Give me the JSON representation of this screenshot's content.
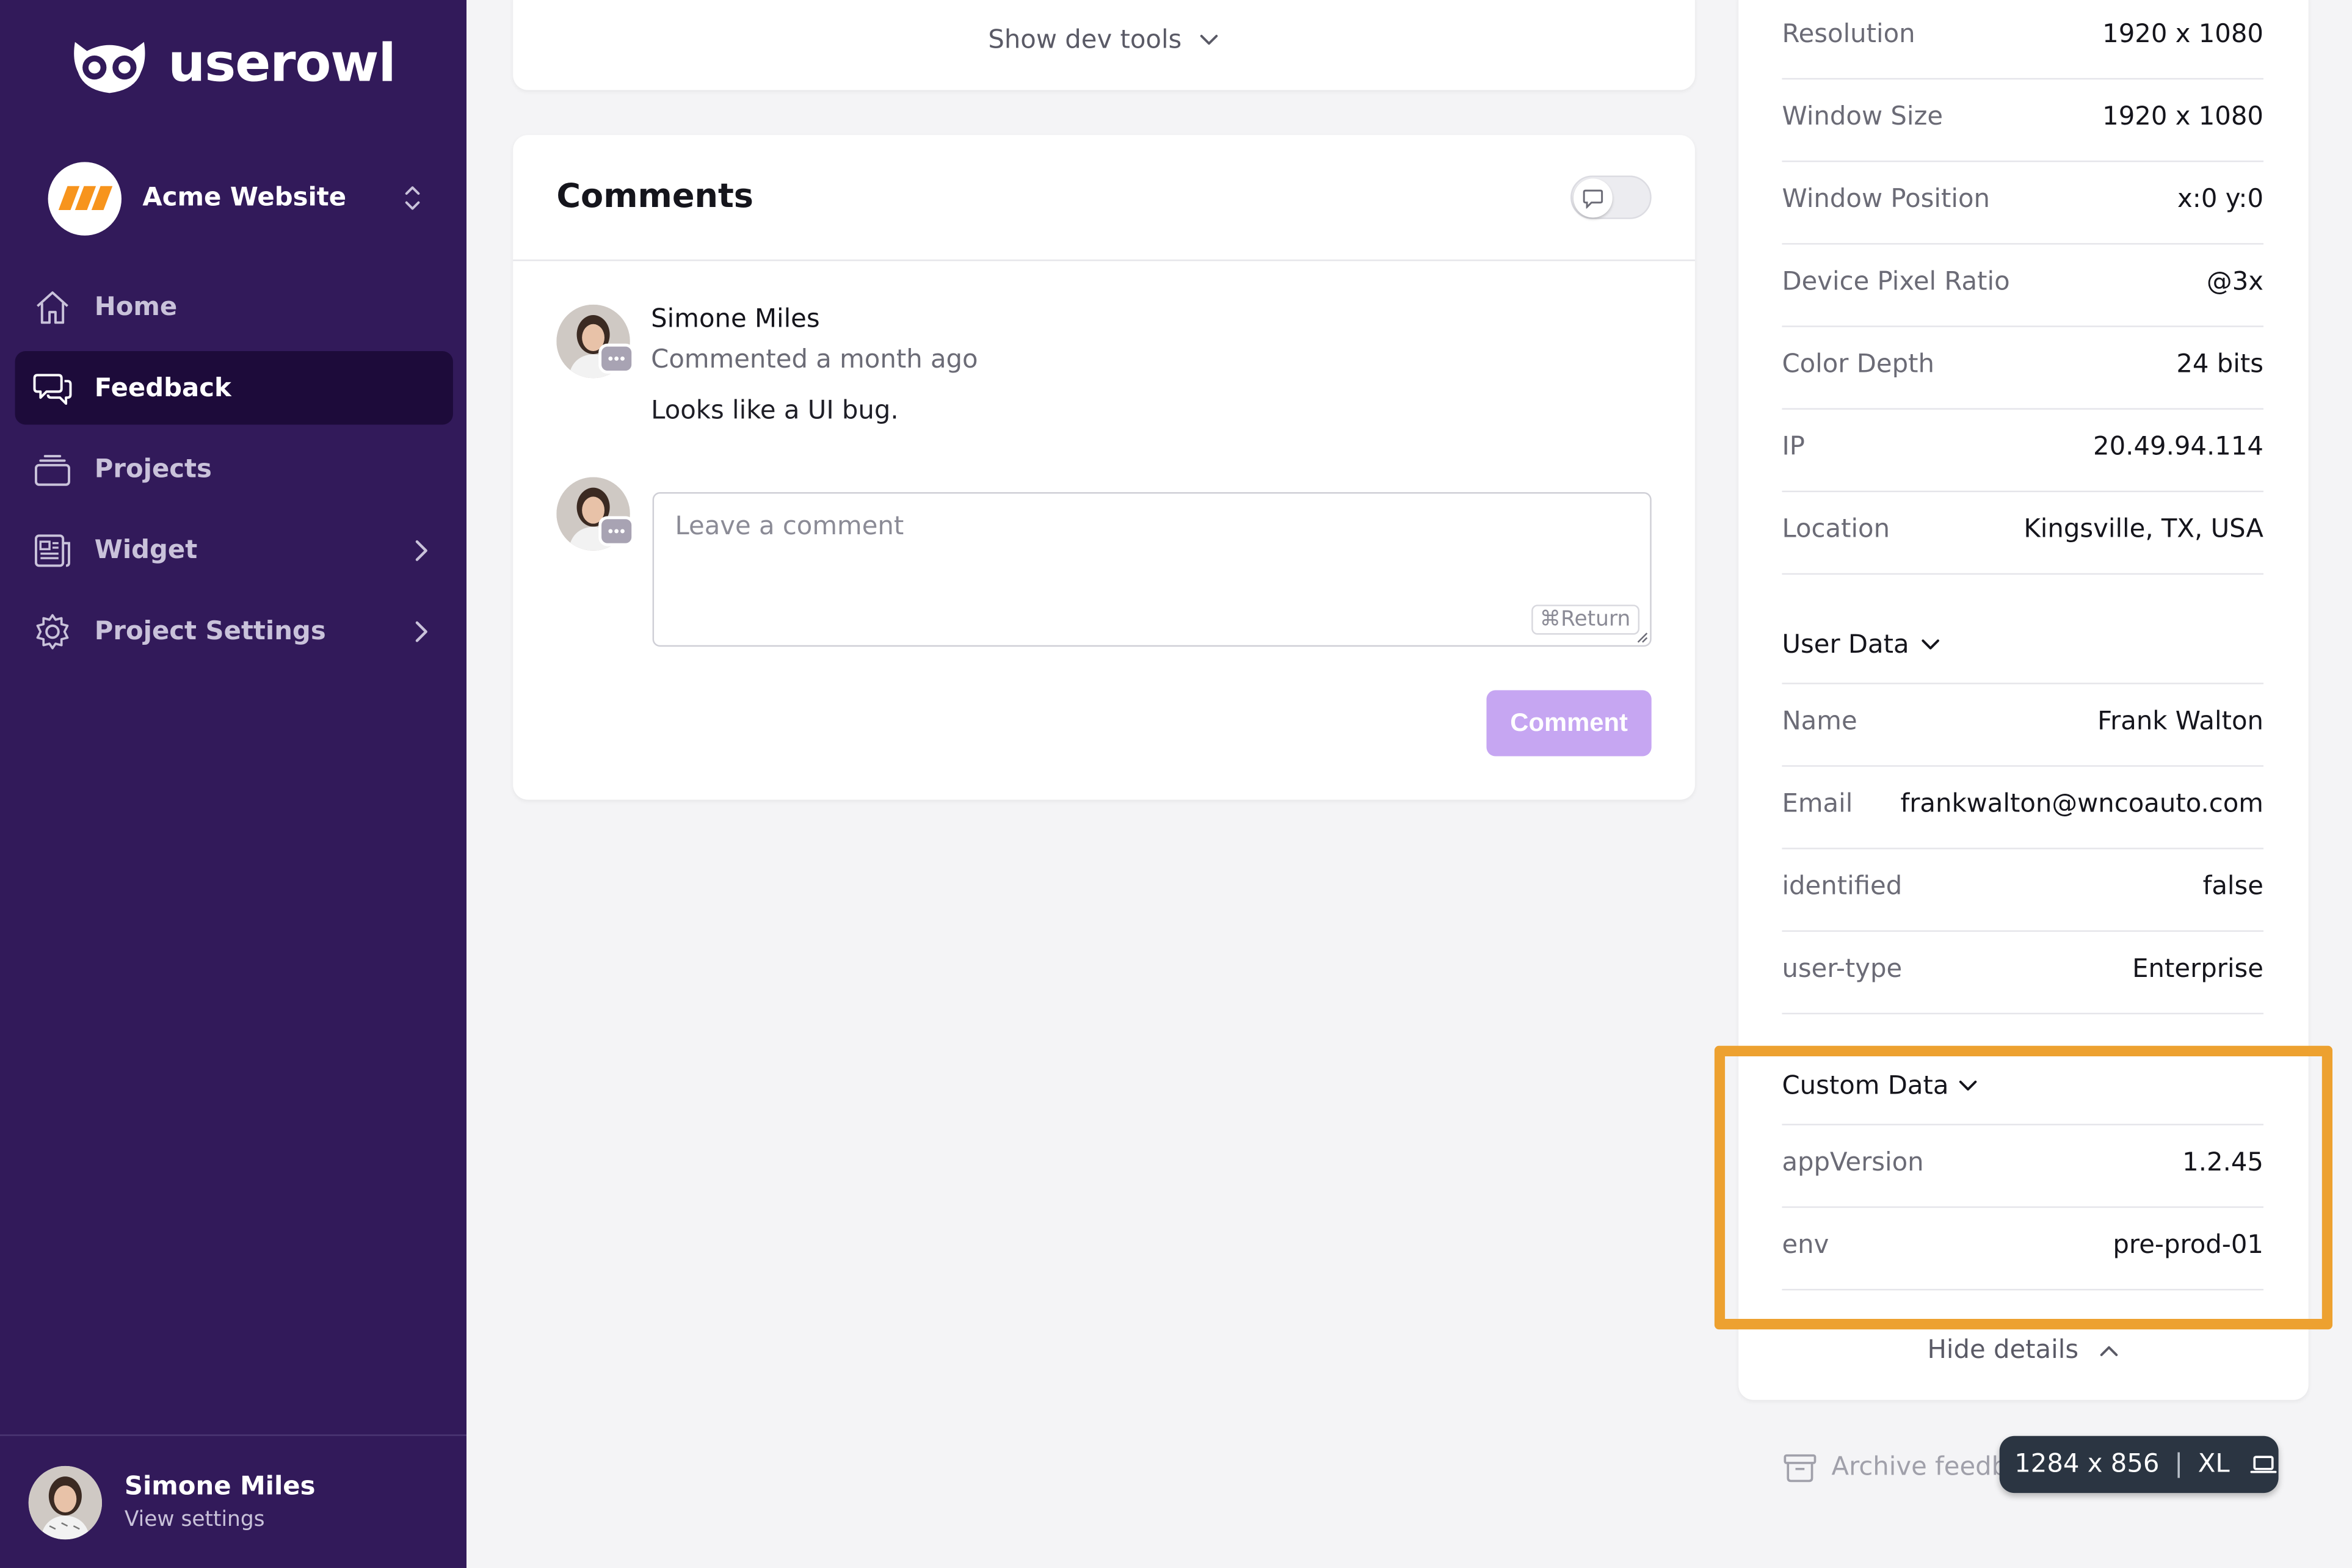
{
  "app": {
    "logo_text": "userowl"
  },
  "project": {
    "name": "Acme Website"
  },
  "nav": {
    "items": [
      {
        "label": "Home",
        "icon": "home-icon",
        "active": false
      },
      {
        "label": "Feedback",
        "icon": "chat-bubbles-icon",
        "active": true
      },
      {
        "label": "Projects",
        "icon": "folder-stack-icon",
        "active": false
      },
      {
        "label": "Widget",
        "icon": "newspaper-icon",
        "active": false,
        "has_children": true
      },
      {
        "label": "Project Settings",
        "icon": "gear-icon",
        "active": false,
        "has_children": true
      }
    ]
  },
  "user": {
    "name": "Simone Miles",
    "sub": "View settings"
  },
  "devtools": {
    "label": "Show dev tools"
  },
  "comments": {
    "title": "Comments",
    "items": [
      {
        "author": "Simone Miles",
        "time": "Commented a month ago",
        "body": "Looks like a UI bug."
      }
    ],
    "input_placeholder": "Leave a comment",
    "shortcut": "⌘Return",
    "submit_label": "Comment"
  },
  "details": {
    "device_rows": [
      {
        "key": "Resolution",
        "value": "1920 x 1080"
      },
      {
        "key": "Window Size",
        "value": "1920 x 1080"
      },
      {
        "key": "Window Position",
        "value": "x:0 y:0"
      },
      {
        "key": "Device Pixel Ratio",
        "value": "@3x"
      },
      {
        "key": "Color Depth",
        "value": "24 bits"
      },
      {
        "key": "IP",
        "value": "20.49.94.114"
      },
      {
        "key": "Location",
        "value": "Kingsville, TX, USA"
      }
    ],
    "user_data": {
      "title": "User Data",
      "rows": [
        {
          "key": "Name",
          "value": "Frank Walton"
        },
        {
          "key": "Email",
          "value": "frankwalton@wncoauto.com"
        },
        {
          "key": "identified",
          "value": "false"
        },
        {
          "key": "user-type",
          "value": "Enterprise"
        }
      ]
    },
    "custom_data": {
      "title": "Custom Data",
      "rows": [
        {
          "key": "appVersion",
          "value": "1.2.45"
        },
        {
          "key": "env",
          "value": "pre-prod-01"
        }
      ]
    },
    "hide_label": "Hide details"
  },
  "archive": {
    "label": "Archive feedb"
  },
  "viewport_badge": {
    "size": "1284 x 856",
    "breakpoint": "XL"
  },
  "colors": {
    "sidebar": "#321a5a",
    "sidebar_active": "#1d0b3a",
    "accent_button": "#c6a6f2",
    "highlight": "#eda130",
    "brand_orange": "#f7941d"
  }
}
